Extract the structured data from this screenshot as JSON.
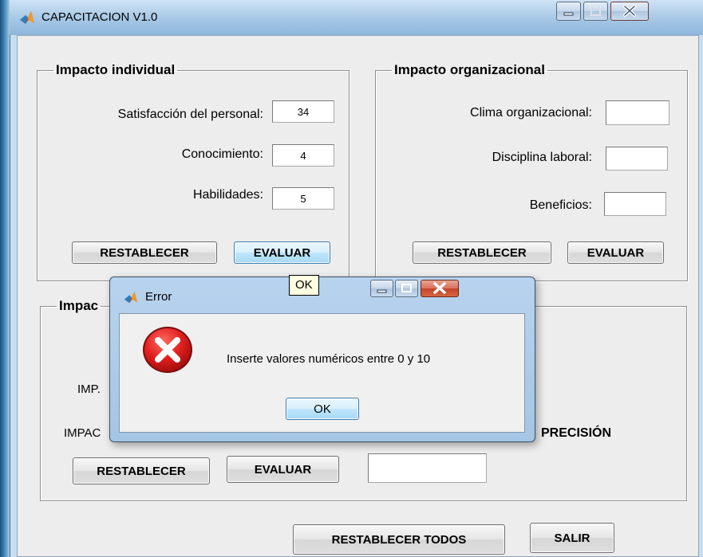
{
  "window": {
    "title": "CAPACITACION V1.0"
  },
  "panels": {
    "individual": {
      "title": "Impacto individual",
      "fields": [
        {
          "label": "Satisfacción del personal:",
          "value": "34"
        },
        {
          "label": "Conocimiento:",
          "value": "4"
        },
        {
          "label": "Habilidades:",
          "value": "5"
        }
      ],
      "reset_label": "RESTABLECER",
      "evaluate_label": "EVALUAR"
    },
    "organizational": {
      "title": "Impacto organizacional",
      "fields": [
        {
          "label": "Clima organizacional:",
          "value": ""
        },
        {
          "label": "Disciplina laboral:",
          "value": ""
        },
        {
          "label": "Beneficios:",
          "value": ""
        }
      ],
      "reset_label": "RESTABLECER",
      "evaluate_label": "EVALUAR"
    },
    "third": {
      "title_visible": "Impac",
      "row1_label_visible": "IMP.",
      "row2_label_visible": "IMPAC",
      "precision_label": "PRECISIÓN",
      "precision_value": "",
      "reset_label": "RESTABLECER",
      "evaluate_label": "EVALUAR"
    }
  },
  "footer": {
    "reset_all_label": "RESTABLECER TODOS",
    "exit_label": "SALIR"
  },
  "dialog": {
    "title": "Error",
    "message": "Inserte valores numéricos entre 0 y 10",
    "ok_label": "OK",
    "tooltip": "OK"
  },
  "colors": {
    "titlebar": "#a9c9e6",
    "client_bg": "#ededed",
    "error_red": "#d31f1f",
    "close_red": "#c2452b"
  }
}
